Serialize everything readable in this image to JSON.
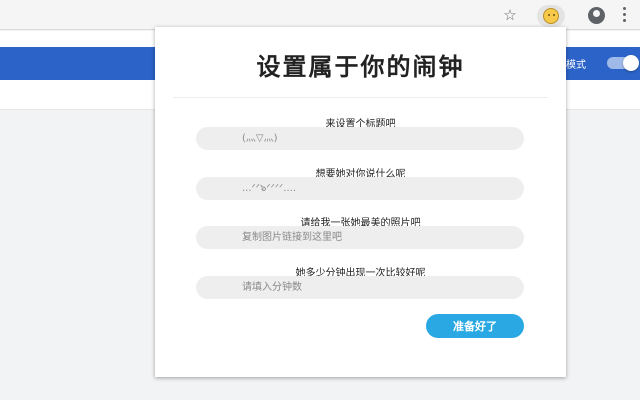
{
  "browser": {
    "icons": [
      "star-icon",
      "extension-icon",
      "profile-icon",
      "menu-icon"
    ]
  },
  "app": {
    "mode_label": "模式",
    "header_color": "#2b63c8"
  },
  "popup": {
    "title": "设置属于你的闹钟",
    "fields": [
      {
        "label": "来设置个标题吧",
        "placeholder": "(灬▽灬)"
      },
      {
        "label": "想要她对你说什么呢",
        "placeholder": "...ᐟᐟ๖ᐟᐟᐟᐟ...."
      },
      {
        "label": "请给我一张她最美的照片吧",
        "placeholder": "复制图片链接到这里吧"
      },
      {
        "label": "她多少分钟出现一次比较好呢",
        "placeholder": "请填入分钟数"
      }
    ],
    "submit_label": "准备好了",
    "accent_color": "#2aa8e4"
  }
}
